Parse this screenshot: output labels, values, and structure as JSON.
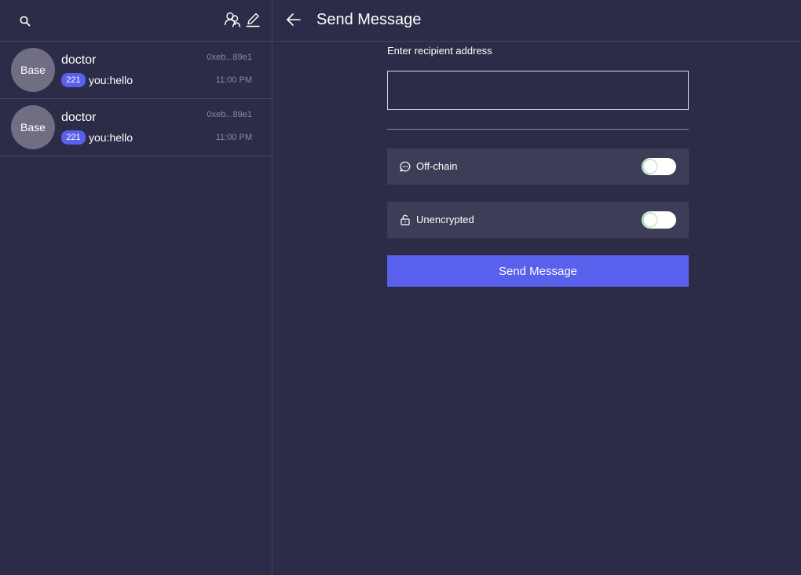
{
  "sidebar": {
    "conversations": [
      {
        "avatar_label": "Base",
        "name": "doctor",
        "badge": "221",
        "preview": "you:hello",
        "address": "0xeb...89e1",
        "time": "11:00 PM"
      },
      {
        "avatar_label": "Base",
        "name": "doctor",
        "badge": "221",
        "preview": "you:hello",
        "address": "0xeb...89e1",
        "time": "11:00 PM"
      }
    ]
  },
  "header": {
    "title": "Send Message"
  },
  "form": {
    "recipient_label": "Enter recipient address",
    "recipient_value": "",
    "offchain_label": "Off-chain",
    "offchain_enabled": false,
    "unencrypted_label": "Unencrypted",
    "unencrypted_enabled": false,
    "send_label": "Send Message"
  },
  "icons": {
    "search": "search-icon",
    "contacts": "contacts-icon",
    "compose": "pencil-icon",
    "back": "arrow-left-icon",
    "offchain": "chat-bubble-icon",
    "unencrypted": "unlock-icon"
  },
  "colors": {
    "background": "#2c2c48",
    "accent": "#5860ec",
    "row": "#3e3d57",
    "avatar": "#6f6e83",
    "muted_text": "#8b8aa3",
    "toggle_ring": "#5ac27a"
  }
}
